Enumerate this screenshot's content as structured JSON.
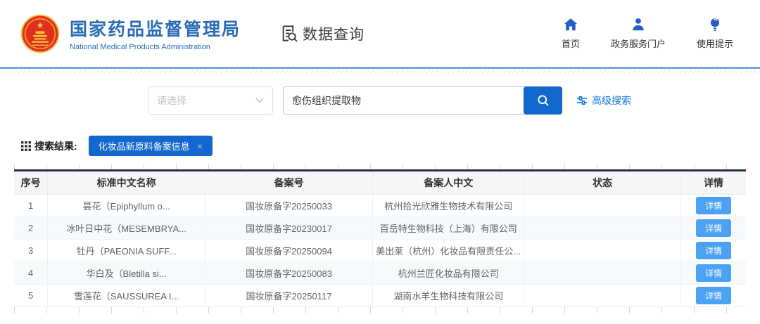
{
  "header": {
    "org_name_cn": "国家药品监督管理局",
    "org_name_en": "National Medical Products Administration",
    "app_title": "数据查询",
    "nav": [
      {
        "label": "首页",
        "icon": "home-icon"
      },
      {
        "label": "政务服务门户",
        "icon": "user-icon"
      },
      {
        "label": "使用提示",
        "icon": "bulb-icon"
      }
    ]
  },
  "search": {
    "select_placeholder": "请选择",
    "query_value": "愈伤组织提取物",
    "advanced_label": "高级搜索"
  },
  "results": {
    "label": "搜索结果:",
    "tag": "化妆品新原料备案信息",
    "tag_close": "×"
  },
  "table": {
    "columns": [
      "序号",
      "标准中文名称",
      "备案号",
      "备案人中文",
      "状态",
      "详情"
    ],
    "detail_label": "详情",
    "rows": [
      {
        "no": "1",
        "name": "昙花（Epiphyllum o...",
        "reg_no": "国妆原备字20250033",
        "registrant": "杭州拾光欣雅生物技术有限公司",
        "status": ""
      },
      {
        "no": "2",
        "name": "冰叶日中花（MESEMBRYA...",
        "reg_no": "国妆原备字20230017",
        "registrant": "百岳特生物科技（上海）有限公司",
        "status": ""
      },
      {
        "no": "3",
        "name": "牡丹（PAEONIA SUFF...",
        "reg_no": "国妆原备字20250094",
        "registrant": "美出莱（杭州）化妆品有限责任公...",
        "status": ""
      },
      {
        "no": "4",
        "name": "华白及（Bletilla si...",
        "reg_no": "国妆原备字20250083",
        "registrant": "杭州兰匠化妆品有限公司",
        "status": ""
      },
      {
        "no": "5",
        "name": "雪莲花（SAUSSUREA I...",
        "reg_no": "国妆原备字20250117",
        "registrant": "湖南水羊生物科技有限公司",
        "status": ""
      }
    ]
  },
  "colors": {
    "brand_blue": "#2a6bb5",
    "accent_blue": "#1268cc",
    "link_blue": "#1677d9",
    "detail_button_blue": "#4ca2f2",
    "table_top_border": "#233142"
  }
}
